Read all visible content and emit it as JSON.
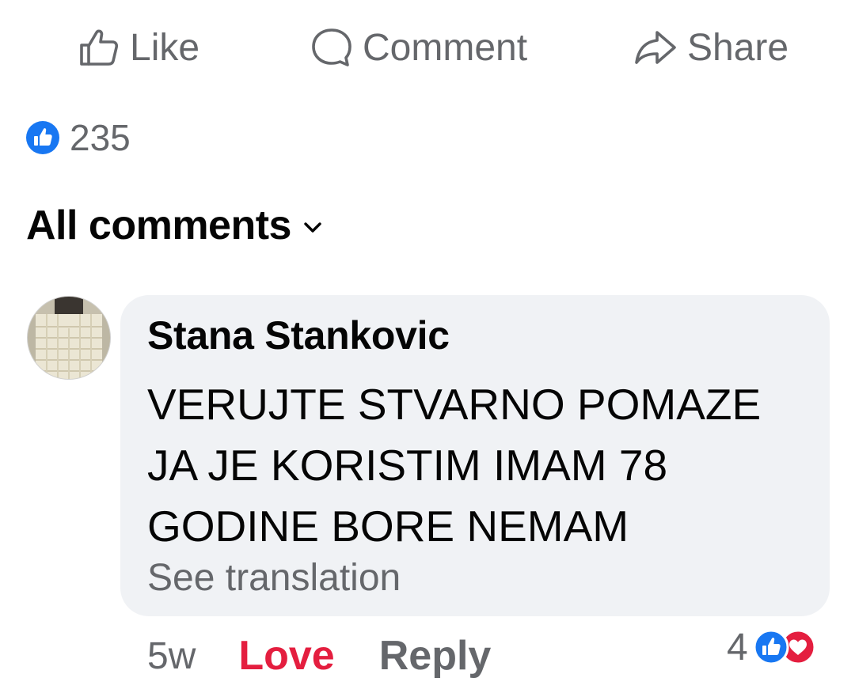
{
  "actions": {
    "like_label": "Like",
    "comment_label": "Comment",
    "share_label": "Share"
  },
  "reactions": {
    "icon": "like-badge-icon",
    "count": "235"
  },
  "comments_filter": {
    "label": "All comments"
  },
  "comment": {
    "author": "Stana Stankovic",
    "text_lines": [
      "VERUJTE STVARNO POMAZE",
      "JA JE KORISTIM IMAM 78",
      "GODINE BORE NEMAM"
    ],
    "translation_link": "See translation",
    "time": "5w",
    "love_label": "Love",
    "reply_label": "Reply",
    "reaction_count": "4",
    "reaction_icons": [
      "like-badge-icon",
      "love-badge-icon"
    ]
  },
  "colors": {
    "secondary_text": "#65676b",
    "primary_text": "#050505",
    "bubble_bg": "#f0f2f5",
    "like_blue": "#1877f2",
    "love_red": "#e41e3f"
  }
}
